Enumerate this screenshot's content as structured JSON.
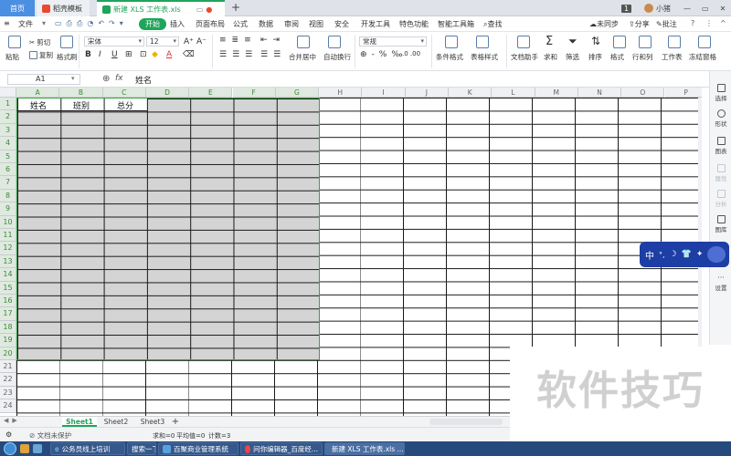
{
  "titlebar": {
    "tabs": [
      {
        "label": "首页"
      },
      {
        "label": "稻壳模板"
      },
      {
        "label": "新建 XLS 工作表.xls"
      }
    ],
    "page_badge": "1",
    "user": "小猪"
  },
  "menubar": {
    "file": "文件",
    "items": [
      "开始",
      "插入",
      "页面布局",
      "公式",
      "数据",
      "审阅",
      "视图",
      "安全",
      "开发工具",
      "特色功能",
      "智能工具箱"
    ],
    "search": "查找",
    "sync": "未同步",
    "share": "分享",
    "annotate": "批注"
  },
  "ribbon": {
    "paste": "粘贴",
    "cut": "剪切",
    "copy": "复制",
    "format_painter": "格式刷",
    "font_name": "宋体",
    "font_size": "12",
    "number_format": "常规",
    "merge_center": "合并居中",
    "wrap_text": "自动换行",
    "cond_format": "条件格式",
    "table_style": "表格样式",
    "doc_helper": "文档助手",
    "sum": "求和",
    "filter": "筛选",
    "sort": "排序",
    "format": "格式",
    "rows_cols": "行和列",
    "worksheet": "工作表",
    "freeze": "冻结窗格"
  },
  "formula_bar": {
    "name_box": "A1",
    "fx": "fx",
    "value": "姓名"
  },
  "grid": {
    "columns": [
      "A",
      "B",
      "C",
      "D",
      "E",
      "F",
      "G",
      "H",
      "I",
      "J",
      "K",
      "L",
      "M",
      "N",
      "O",
      "P"
    ],
    "rows": [
      "1",
      "2",
      "3",
      "4",
      "5",
      "6",
      "7",
      "8",
      "9",
      "10",
      "11",
      "12",
      "13",
      "14",
      "15",
      "16",
      "17",
      "18",
      "19",
      "20",
      "21",
      "22",
      "23",
      "24"
    ],
    "header_cells": [
      "姓名",
      "班别",
      "总分"
    ]
  },
  "side_panel": [
    "选择",
    "形状",
    "图表",
    "属性",
    "分析",
    "图库",
    "设置"
  ],
  "sheets": {
    "tabs": [
      "Sheet1",
      "Sheet2",
      "Sheet3"
    ],
    "add": "+"
  },
  "status": {
    "protect": "文档未保护",
    "sum": "求和=0",
    "avg": "平均值=0",
    "count": "计数=3"
  },
  "ime": {
    "label": "中"
  },
  "watermark": "软件技巧",
  "taskbar": {
    "items": [
      "公务员线上培训",
      "搜索一下",
      "百聚商业管理系统",
      "问你编辑器_百度经...",
      "新建 XLS 工作表.xls ..."
    ]
  }
}
